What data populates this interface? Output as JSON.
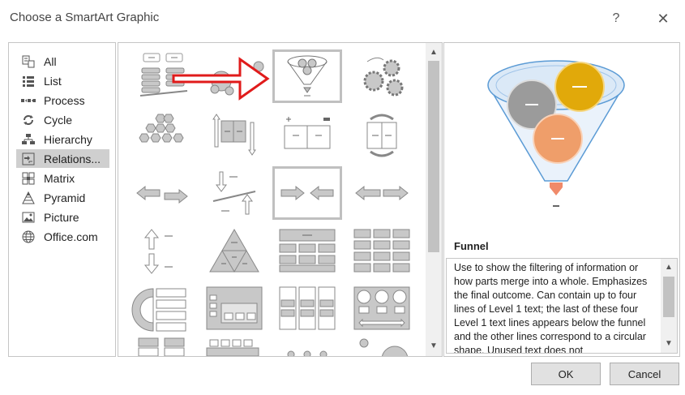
{
  "window": {
    "title": "Choose a SmartArt Graphic",
    "help_label": "?",
    "close_label": "✕"
  },
  "categories": [
    {
      "label": "All",
      "icon": "all-icon",
      "selected": false
    },
    {
      "label": "List",
      "icon": "list-icon",
      "selected": false
    },
    {
      "label": "Process",
      "icon": "process-icon",
      "selected": false
    },
    {
      "label": "Cycle",
      "icon": "cycle-icon",
      "selected": false
    },
    {
      "label": "Hierarchy",
      "icon": "hierarchy-icon",
      "selected": false
    },
    {
      "label": "Relations...",
      "icon": "relationship-icon",
      "selected": true
    },
    {
      "label": "Matrix",
      "icon": "matrix-icon",
      "selected": false
    },
    {
      "label": "Pyramid",
      "icon": "pyramid-icon",
      "selected": false
    },
    {
      "label": "Picture",
      "icon": "picture-icon",
      "selected": false
    },
    {
      "label": "Office.com",
      "icon": "globe-icon",
      "selected": false
    }
  ],
  "gallery": {
    "selected": "funnel",
    "scroll_up": "▲",
    "scroll_down": "▼"
  },
  "preview": {
    "name": "Funnel",
    "description": "Use to show the filtering of information or how parts merge into a whole. Emphasizes the final outcome. Can contain up to four lines of Level 1 text; the last of these four Level 1 text lines appears below the funnel and the other lines  correspond to a circular shape. Unused text does not",
    "circle_colors": [
      "#9b9b9b",
      "#e1a90a",
      "#ef9e6a"
    ],
    "funnel_color": "#5b9bd5",
    "arrow_color": "#f08a6a"
  },
  "buttons": {
    "ok": "OK",
    "cancel": "Cancel"
  },
  "colors": {
    "annotation_arrow": "#e01b1b",
    "selection_background": "#cfcfcf"
  }
}
